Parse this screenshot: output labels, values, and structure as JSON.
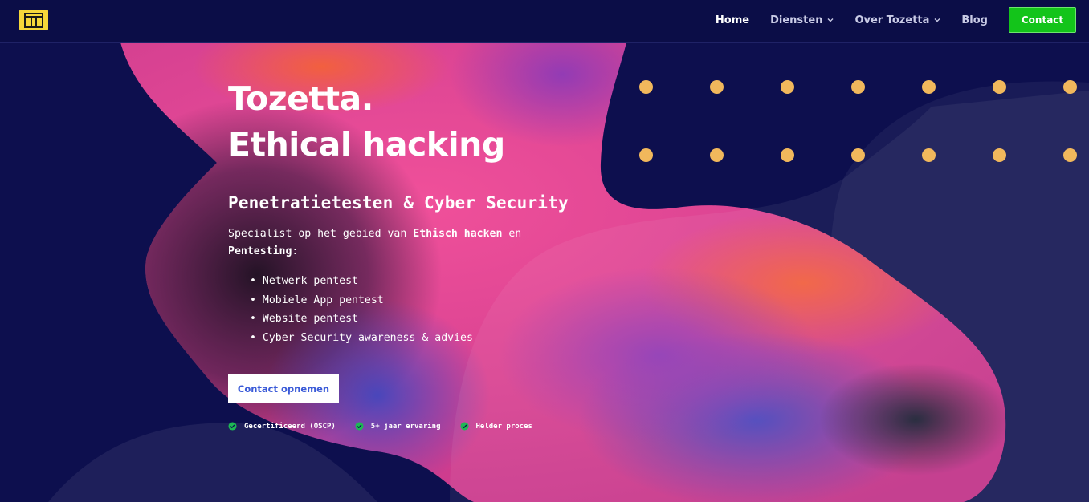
{
  "header": {
    "nav": [
      {
        "label": "Home",
        "active": true,
        "dropdown": false
      },
      {
        "label": "Diensten",
        "active": false,
        "dropdown": true
      },
      {
        "label": "Over Tozetta",
        "active": false,
        "dropdown": true
      },
      {
        "label": "Blog",
        "active": false,
        "dropdown": false
      }
    ],
    "contact_label": "Contact"
  },
  "hero": {
    "title_line1": "Tozetta.",
    "title_line2": "Ethical hacking",
    "subtitle": "Penetratietesten & Cyber Security",
    "desc_prefix": "Specialist op het gebied van ",
    "desc_bold1": "Ethisch hacken",
    "desc_mid": " en ",
    "desc_bold2": "Pentesting",
    "desc_suffix": ":",
    "services": [
      "Netwerk pentest",
      "Mobiele App pentest",
      "Website pentest",
      "Cyber Security awareness & advies"
    ],
    "cta_label": "Contact opnemen",
    "badges": [
      "Gecertificeerd (OSCP)",
      "5+ jaar ervaring",
      "Helder proces"
    ]
  },
  "colors": {
    "background": "#0d0f4e",
    "accent_logo": "#f5d63a",
    "contact_button": "#13c41a",
    "dots": "#f1b85c",
    "cta_text": "#3b5bd8"
  },
  "icons": [
    "logo-icon",
    "chevron-down-icon",
    "check-circle-icon"
  ]
}
